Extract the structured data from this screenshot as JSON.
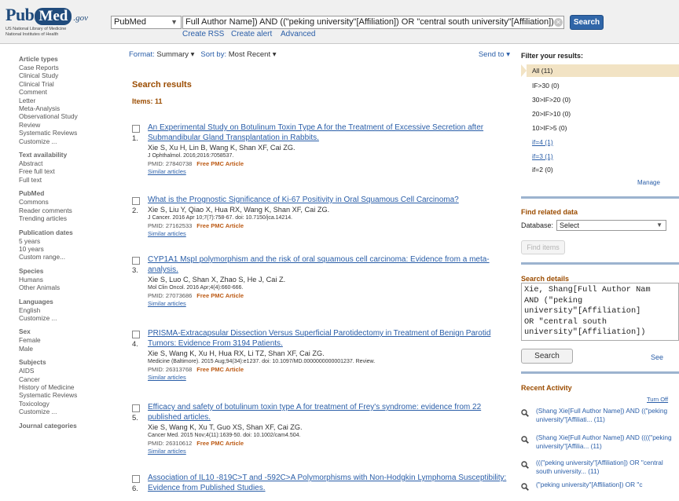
{
  "header": {
    "logo": {
      "main_pub": "Pub",
      "main_med": "Med",
      "gov": ".gov",
      "sub_line1": "US National Library of Medicine",
      "sub_line2": "National Institutes of Health"
    },
    "database": "PubMed",
    "query": "Full Author Name]) AND ((\"peking university\"[Affiliation]) OR \"central south university\"[Affiliation])",
    "search_label": "Search",
    "links": [
      "Create RSS",
      "Create alert",
      "Advanced"
    ]
  },
  "sidebar": [
    {
      "heading": "Article types",
      "items": [
        "Case Reports",
        "Clinical Study",
        "Clinical Trial",
        "Comment",
        "Letter",
        "Meta-Analysis",
        "Observational Study",
        "Review",
        "Systematic Reviews",
        "Customize ..."
      ]
    },
    {
      "heading": "Text availability",
      "items": [
        "Abstract",
        "Free full text",
        "Full text"
      ]
    },
    {
      "heading": "PubMed",
      "items": [
        "Commons",
        "Reader comments",
        "Trending articles"
      ]
    },
    {
      "heading": "Publication dates",
      "items": [
        "5 years",
        "10 years",
        "Custom range..."
      ]
    },
    {
      "heading": "Species",
      "items": [
        "Humans",
        "Other Animals"
      ]
    },
    {
      "heading": "Languages",
      "items": [
        "English",
        "Customize ..."
      ]
    },
    {
      "heading": "Sex",
      "items": [
        "Female",
        "Male"
      ]
    },
    {
      "heading": "Subjects",
      "items": [
        "AIDS",
        "Cancer",
        "History of Medicine",
        "Systematic Reviews",
        "Toxicology",
        "Customize ..."
      ]
    },
    {
      "heading": "Journal categories",
      "items": []
    }
  ],
  "main": {
    "format_label": "Format:",
    "format_value": "Summary",
    "sort_label": "Sort by:",
    "sort_value": "Most Recent",
    "send_to": "Send to",
    "title": "Search results",
    "items_count": "Items: 11",
    "results": [
      {
        "num": "1.",
        "title": "An Experimental Study on Botulinum Toxin Type A for the Treatment of Excessive Secretion after Submandibular Gland Transplantation in Rabbits.",
        "authors": "Xie S, Xu H, Lin B, Wang K, Shan XF, Cai ZG.",
        "citation": "J Ophthalmol. 2016;2016:7058537.",
        "pmid": "PMID: 27840738",
        "free": "Free PMC Article",
        "similar": "Similar articles"
      },
      {
        "num": "2.",
        "title": "What is the Prognostic Significance of Ki-67 Positivity in Oral Squamous Cell Carcinoma?",
        "authors": "Xie S, Liu Y, Qiao X, Hua RX, Wang K, Shan XF, Cai ZG.",
        "citation": "J Cancer. 2016 Apr 10;7(7):758-67. doi: 10.7150/jca.14214.",
        "pmid": "PMID: 27162533",
        "free": "Free PMC Article",
        "similar": "Similar articles"
      },
      {
        "num": "3.",
        "title": "CYP1A1 MspI polymorphism and the risk of oral squamous cell carcinoma: Evidence from a meta-analysis.",
        "authors": "Xie S, Luo C, Shan X, Zhao S, He J, Cai Z.",
        "citation": "Mol Clin Oncol. 2016 Apr;4(4):660-666.",
        "pmid": "PMID: 27073686",
        "free": "Free PMC Article",
        "similar": "Similar articles"
      },
      {
        "num": "4.",
        "title": "PRISMA-Extracapsular Dissection Versus Superficial Parotidectomy in Treatment of Benign Parotid Tumors: Evidence From 3194 Patients.",
        "authors": "Xie S, Wang K, Xu H, Hua RX, Li TZ, Shan XF, Cai ZG.",
        "citation": "Medicine (Baltimore). 2015 Aug;94(34):e1237. doi: 10.1097/MD.0000000000001237. Review.",
        "pmid": "PMID: 26313768",
        "free": "Free PMC Article",
        "similar": "Similar articles"
      },
      {
        "num": "5.",
        "title": "Efficacy and safety of botulinum toxin type A for treatment of Frey's syndrome: evidence from 22 published articles.",
        "authors": "Xie S, Wang K, Xu T, Guo XS, Shan XF, Cai ZG.",
        "citation": "Cancer Med. 2015 Nov;4(11):1639-50. doi: 10.1002/cam4.504.",
        "pmid": "PMID: 26310612",
        "free": "Free PMC Article",
        "similar": "Similar articles"
      },
      {
        "num": "6.",
        "title": "Association of IL10 -819C>T and -592C>A Polymorphisms with Non-Hodgkin Lymphoma Susceptibility: Evidence from Published Studies.",
        "authors": "",
        "citation": "",
        "pmid": "",
        "free": "",
        "similar": ""
      }
    ]
  },
  "right": {
    "filter_heading": "Filter your results:",
    "filters": [
      "All (11)",
      "IF>30 (0)",
      "30>IF>20 (0)",
      "20>IF>10 (0)",
      "10>IF>5 (0)",
      "if=4 (1)",
      "if=3 (1)",
      "if=2 (0)"
    ],
    "manage": "Manage",
    "find_related_heading": "Find related data",
    "database_label": "Database:",
    "database_value": "Select",
    "find_items": "Find items",
    "search_details_heading": "Search details",
    "query_lines": [
      "Xie, Shang[Full Author Nam",
      "AND (\"peking",
      "university\"[Affiliation]",
      "OR \"central south",
      "university\"[Affiliation])"
    ],
    "details_search": "Search",
    "see": "See",
    "recent_activity_heading": "Recent Activity",
    "turn_off": "Turn Off",
    "recent": [
      "(Shang Xie[Full Author Name]) AND ((\"peking university\"[Affiliati... (11)",
      "(Shang Xie[Full Author Name]) AND ((((\"peking university\"[Affilia... (11)",
      "(((\"peking university\"[Affiliation]) OR \"central south university... (11)",
      "(\"peking university\"[Affiliation]) OR \"c"
    ]
  }
}
